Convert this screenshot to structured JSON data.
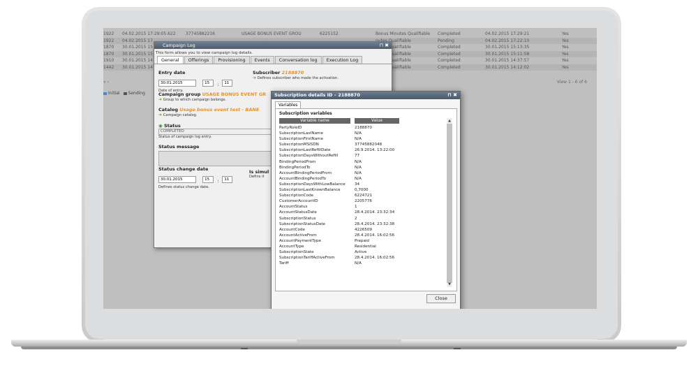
{
  "background_table": {
    "rows": [
      {
        "id": "1922",
        "date": "04.02.2015 17:29:05.622",
        "sub": "37745882216",
        "campaign": "USAGE BONUS EVENT GROU",
        "code": "6225152",
        "offering": "Bonus Minutes Qualifiable",
        "status": "Completed",
        "date2": "04.02.2015 17:29:21",
        "flag": "Yes"
      },
      {
        "id": "1922",
        "date": "04.02.2015 17",
        "sub": "",
        "campaign": "",
        "code": "",
        "offering": "nutes Qualifiable",
        "status": "Pending",
        "date2": "04.02.2015 17:22:10",
        "flag": "Yes"
      },
      {
        "id": "1870",
        "date": "30.01.2015 15",
        "sub": "",
        "campaign": "",
        "code": "",
        "offering": "nutes Qualifiable",
        "status": "Completed",
        "date2": "30.01.2015 15:13:35",
        "flag": "Yes"
      },
      {
        "id": "1870",
        "date": "30.01.2015 15",
        "sub": "",
        "campaign": "",
        "code": "",
        "offering": "nutes Qualifiable",
        "status": "Completed",
        "date2": "30.01.2015 15:11:58",
        "flag": "Yes"
      },
      {
        "id": "1910",
        "date": "30.01.2015 14",
        "sub": "",
        "campaign": "",
        "code": "",
        "offering": "nutes Qualifiable",
        "status": "Completed",
        "date2": "30.01.2015 14:37:57",
        "flag": "Yes"
      },
      {
        "id": "1442",
        "date": "30.01.2015 14",
        "sub": "",
        "campaign": "",
        "code": "",
        "offering": "nutes Qualifiable",
        "status": "Completed",
        "date2": "30.01.2015 14:12:02",
        "flag": "Yes"
      }
    ],
    "pagenav": "« ‹",
    "pager": "View 1 - 6 of 6",
    "legend": [
      "Initial",
      "Sending"
    ]
  },
  "campaign_log": {
    "title": "Campaign Log",
    "description": "This form allows you to view campaign log details.",
    "tabs": [
      "General",
      "Offerings",
      "Provisioning",
      "Events",
      "Conversation log",
      "Execution Log"
    ],
    "entry_date_label": "Entry date",
    "entry_date": "30.01.2015",
    "entry_hour": "15",
    "entry_min": "11",
    "entry_date_help": "Date of entry.",
    "subscriber_label": "Subscriber",
    "subscriber_value": "2188870",
    "subscriber_help": "Defines subscriber who made the activation.",
    "campaign_group_label": "Campaign group",
    "campaign_group_value": "USAGE BONUS EVENT GR",
    "campaign_group_help": "Group to which campaign belongs.",
    "catalog_label": "Catalog",
    "catalog_value": "Usage bonus event test - BANE",
    "catalog_help": "Campaign catalog.",
    "status_label": "Status",
    "status_value": "COMPLETED",
    "status_help": "Status of campaign log entry.",
    "status_message_label": "Status message",
    "status_change_label": "Status change date",
    "status_change_date": "30.01.2015",
    "status_change_hour": "15",
    "status_change_min": "11",
    "status_change_help": "Defines status change date.",
    "is_sim_label": "Is simul",
    "is_sim_help": "Defins it"
  },
  "subscription": {
    "title": "Subscription details ID – 2188870",
    "tab": "Variables",
    "section_title": "Subscription variables",
    "col_name": "Variable name",
    "col_value": "Value",
    "rows": [
      {
        "n": "PartyRoleID",
        "v": "2188870"
      },
      {
        "n": "SubscriptionLastName",
        "v": "N/A"
      },
      {
        "n": "SubscriptionFirstName",
        "v": "N/A"
      },
      {
        "n": "SubscriptionMSISDN",
        "v": "37745882048"
      },
      {
        "n": "SubscriptionLastRefillDate",
        "v": "26.9.2014. 13:22:00"
      },
      {
        "n": "SubscriptionDaysWithoutRefill",
        "v": "77"
      },
      {
        "n": "BindingPeriodFrom",
        "v": "N/A"
      },
      {
        "n": "BindingPeriodTo",
        "v": "N/A"
      },
      {
        "n": "AccountBindingPeriodFrom",
        "v": "N/A"
      },
      {
        "n": "AccountBindingPeriodTo",
        "v": "N/A"
      },
      {
        "n": "SubscriptionDaysWithLowBalance",
        "v": "34"
      },
      {
        "n": "SubscriptionLastKnownBalance",
        "v": "0,7000"
      },
      {
        "n": "SubscriptionCode",
        "v": "6224721"
      },
      {
        "n": "CustomerAccountID",
        "v": "2205776"
      },
      {
        "n": "AccountStatus",
        "v": "1"
      },
      {
        "n": "AccountStatusDate",
        "v": "28.4.2014. 23:32:34"
      },
      {
        "n": "SubscriptionStatus",
        "v": "2"
      },
      {
        "n": "SubscriptionStatusDate",
        "v": "28.4.2014. 23:32:38"
      },
      {
        "n": "AccountCode",
        "v": "4226509"
      },
      {
        "n": "AccountActiveFrom",
        "v": "28.4.2014. 16:02:56"
      },
      {
        "n": "AccountPaymentType",
        "v": "Prepaid"
      },
      {
        "n": "AccountType",
        "v": "Residential"
      },
      {
        "n": "SubscriptionState",
        "v": "Active"
      },
      {
        "n": "SubscriptionTariffActiveFrom",
        "v": "28.4.2014. 16:02:56"
      },
      {
        "n": "Tariff",
        "v": "N/A"
      }
    ],
    "close_label": "Close"
  }
}
